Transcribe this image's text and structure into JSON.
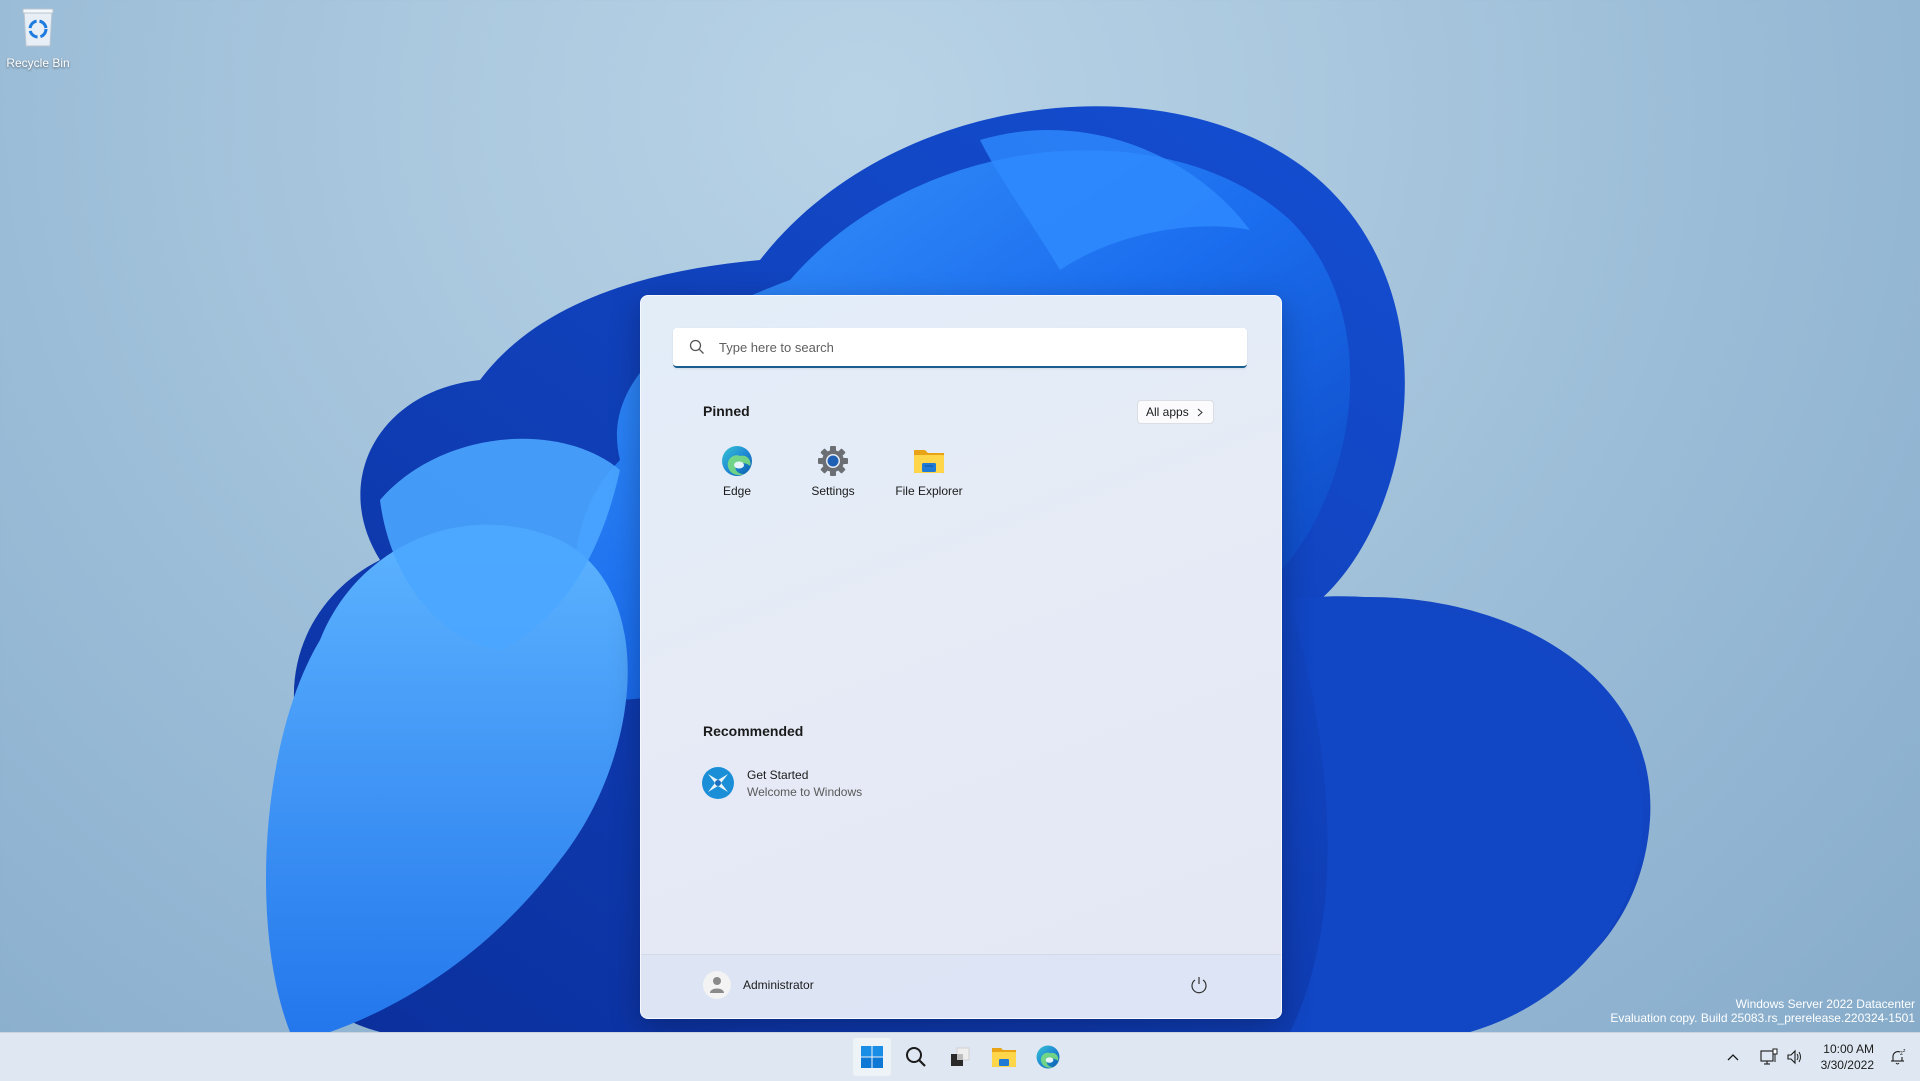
{
  "desktop": {
    "icons": [
      {
        "label": "Recycle Bin",
        "icon": "recycle-bin-icon"
      }
    ],
    "watermark": {
      "line1": "Windows Server 2022 Datacenter",
      "line2": "Evaluation copy. Build 25083.rs_prerelease.220324-1501"
    }
  },
  "start_menu": {
    "search": {
      "placeholder": "Type here to search",
      "value": ""
    },
    "pinned": {
      "title": "Pinned",
      "all_apps_label": "All apps",
      "apps": [
        {
          "label": "Edge",
          "icon": "edge-icon"
        },
        {
          "label": "Settings",
          "icon": "settings-gear-icon"
        },
        {
          "label": "File Explorer",
          "icon": "folder-icon"
        }
      ]
    },
    "recommended": {
      "title": "Recommended",
      "items": [
        {
          "title": "Get Started",
          "subtitle": "Welcome to Windows",
          "icon": "get-started-icon"
        }
      ]
    },
    "footer": {
      "user": "Administrator",
      "power_icon": "power-icon"
    }
  },
  "taskbar": {
    "apps": [
      {
        "name": "Start",
        "icon": "windows-logo-icon",
        "active": true
      },
      {
        "name": "Search",
        "icon": "search-icon"
      },
      {
        "name": "Task View",
        "icon": "task-view-icon"
      },
      {
        "name": "File Explorer",
        "icon": "folder-icon"
      },
      {
        "name": "Microsoft Edge",
        "icon": "edge-icon"
      }
    ],
    "tray": {
      "time": "10:00 AM",
      "date": "3/30/2022"
    }
  },
  "colors": {
    "accent": "#1a5d8f",
    "windows_blue": "#0078d4"
  }
}
